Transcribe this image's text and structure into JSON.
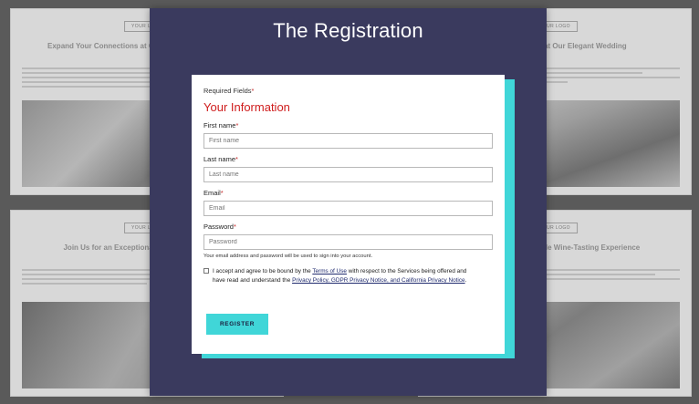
{
  "modal": {
    "title": "The Registration",
    "required_note": "Required Fields",
    "required_marker": "*",
    "section_title": "Your Information",
    "fields": [
      {
        "label": "First name",
        "placeholder": "First name"
      },
      {
        "label": "Last name",
        "placeholder": "Last name"
      },
      {
        "label": "Email",
        "placeholder": "Email"
      },
      {
        "label": "Password",
        "placeholder": "Password"
      }
    ],
    "password_hint": "Your email address and password will be used to sign into your account.",
    "consent": {
      "text_before": "I accept and agree to be bound by the ",
      "terms_link": "Terms of Use",
      "text_middle": " with respect to the Services being offered and have read and understand the ",
      "privacy_link": "Privacy Policy, GDPR Privacy Notice, and California Privacy Notice",
      "text_after": "."
    },
    "register_button": "REGISTER"
  },
  "background_cards": [
    {
      "logo": "YOUR LOGO",
      "headline": "Expand Your Connections at Our Exc... Networking Event"
    },
    {
      "logo": "YOUR LOGO",
      "headline": "...e Love and Joy at Our Elegant Wedding"
    },
    {
      "logo": "YOUR LOGO",
      "headline": "Join Us for an Exceptional Beer Te... Experience"
    },
    {
      "logo": "YOUR LOGO",
      "headline": "...s for an Unforgettable Wine-Tasting Experience"
    }
  ],
  "colors": {
    "modal_bg": "#3a3a5e",
    "accent": "#40d6d8",
    "section_title": "#cf1d1d",
    "required_star": "#c62828"
  }
}
